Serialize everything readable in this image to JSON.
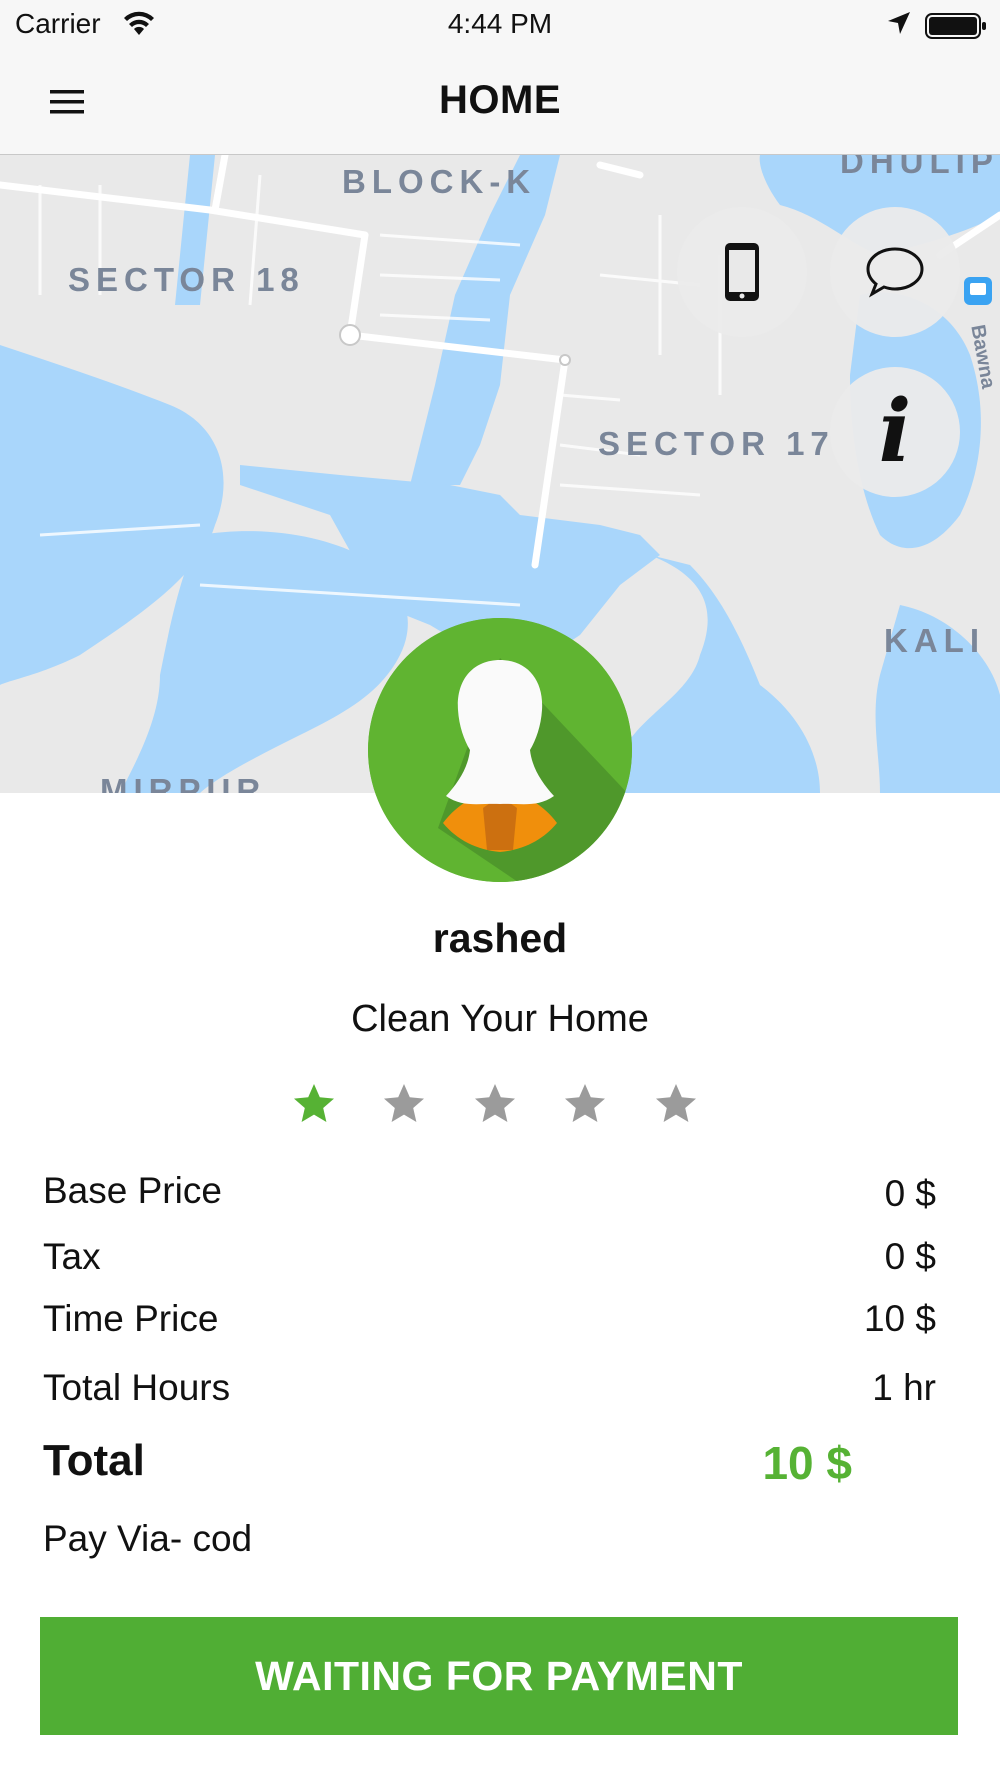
{
  "status_bar": {
    "carrier": "Carrier",
    "time": "4:44 PM"
  },
  "header": {
    "title": "HOME",
    "menu_icon": "hamburger-menu-icon"
  },
  "map": {
    "labels": {
      "block_k": "BLOCK-K",
      "sector_18": "SECTOR 18",
      "sector_17": "SECTOR 17",
      "kali": "KALI",
      "mirpur": "MIRPUR",
      "dhulip": "DHULIP",
      "bawna": "Bawna"
    },
    "water_color": "#a9d6fb",
    "land_color": "#e9e9e9",
    "route_color": "#ffffff"
  },
  "actions": {
    "call_icon": "mobile-phone-icon",
    "chat_icon": "chat-bubble-icon",
    "info_icon": "info-icon",
    "info_glyph": "i"
  },
  "provider": {
    "name": "rashed",
    "service": "Clean Your Home",
    "rating": 1,
    "rating_max": 5
  },
  "pricing": {
    "base_price_label": "Base Price",
    "base_price_value": "0 $",
    "tax_label": "Tax",
    "tax_value": "0 $",
    "time_price_label": "Time Price",
    "time_price_value": "10 $",
    "total_hours_label": "Total Hours",
    "total_hours_value": "1 hr",
    "total_label": "Total",
    "total_value": "10 $",
    "pay_via": "Pay Via- cod"
  },
  "button": {
    "label": "WAITING FOR PAYMENT"
  },
  "colors": {
    "accent": "#50ae34",
    "star_active": "#56b234",
    "star_inactive": "#9b9b9b"
  }
}
